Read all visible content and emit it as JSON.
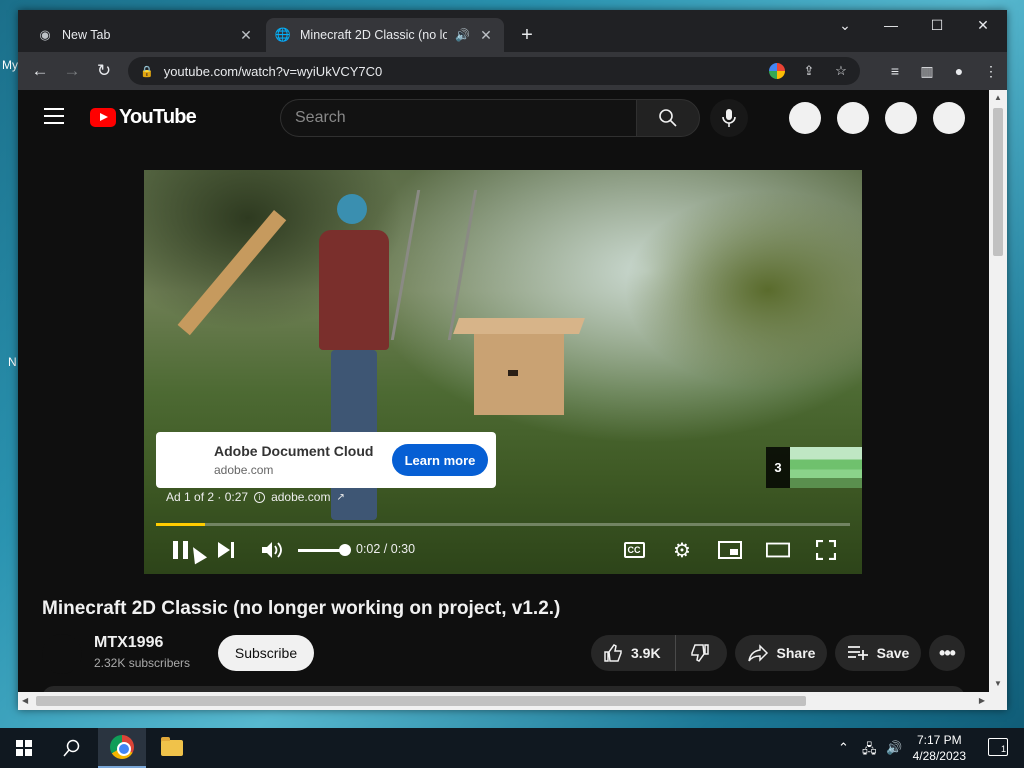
{
  "desktop": {
    "hints": [
      "My",
      "N"
    ]
  },
  "browser": {
    "tabs": [
      {
        "title": "New Tab",
        "icon": "chrome-icon"
      },
      {
        "title": "Minecraft 2D Classic (no longer working on project, v1.2.)",
        "icon": "globe-icon",
        "audio": "speaker-icon"
      }
    ],
    "url": "youtube.com/watch?v=wyiUkVCY7C0",
    "window_controls": {
      "minimize": "—",
      "maximize": "☐",
      "close": "✕",
      "tab_search": "⌄"
    }
  },
  "youtube": {
    "logo_text": "YouTube",
    "search": {
      "placeholder": "Search"
    },
    "ad": {
      "title": "Adobe Document Cloud",
      "domain": "adobe.com",
      "cta": "Learn more",
      "info": "Ad 1 of 2 · 0:27",
      "info_domain": "adobe.com",
      "next_count": "3"
    },
    "player": {
      "progress_fraction": 0.07,
      "volume_fraction": 1.0,
      "time": "0:02 / 0:30",
      "progress_color": "#ffcc00"
    },
    "video": {
      "title": "Minecraft 2D Classic (no longer working on project, v1.2.)",
      "channel": "MTX1996",
      "subscribers": "2.32K subscribers",
      "subscribe_label": "Subscribe",
      "likes": "3.9K",
      "share_label": "Share",
      "save_label": "Save"
    }
  },
  "taskbar": {
    "time": "7:17 PM",
    "date": "4/28/2023",
    "notification_count": "1"
  }
}
